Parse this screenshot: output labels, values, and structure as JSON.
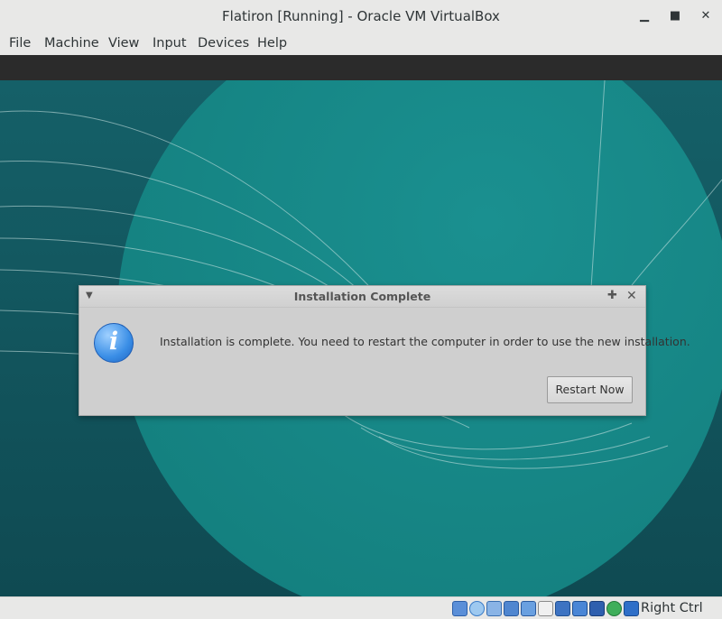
{
  "window": {
    "title": "Flatiron [Running] - Oracle VM VirtualBox",
    "controls": {
      "minimize": "▁",
      "maximize": "■",
      "close": "✕"
    }
  },
  "menubar": [
    "File",
    "Machine",
    "View",
    "Input",
    "Devices",
    "Help"
  ],
  "dialog": {
    "title": "Installation Complete",
    "menu_glyph": "▼",
    "pin_glyph": "✚",
    "close_glyph": "✕",
    "icon": "info-icon",
    "icon_glyph": "i",
    "message": "Installation is complete. You need to restart the computer in order to use the new installation.",
    "button": "Restart Now"
  },
  "statusbar": {
    "icons": [
      "hard-disk-icon",
      "optical-drive-icon",
      "audio-icon",
      "network-icon",
      "usb-icon",
      "shared-folders-icon",
      "display-icon",
      "video-capture-icon",
      "recording-icon",
      "virtualization-icon",
      "mouse-integration-icon"
    ],
    "host_key": "Right Ctrl"
  },
  "colors": {
    "guest_background": "#145056",
    "guest_circle": "#1a8a8c",
    "dialog_background": "#cfcfcf",
    "info_blue": "#3a8ee6"
  }
}
